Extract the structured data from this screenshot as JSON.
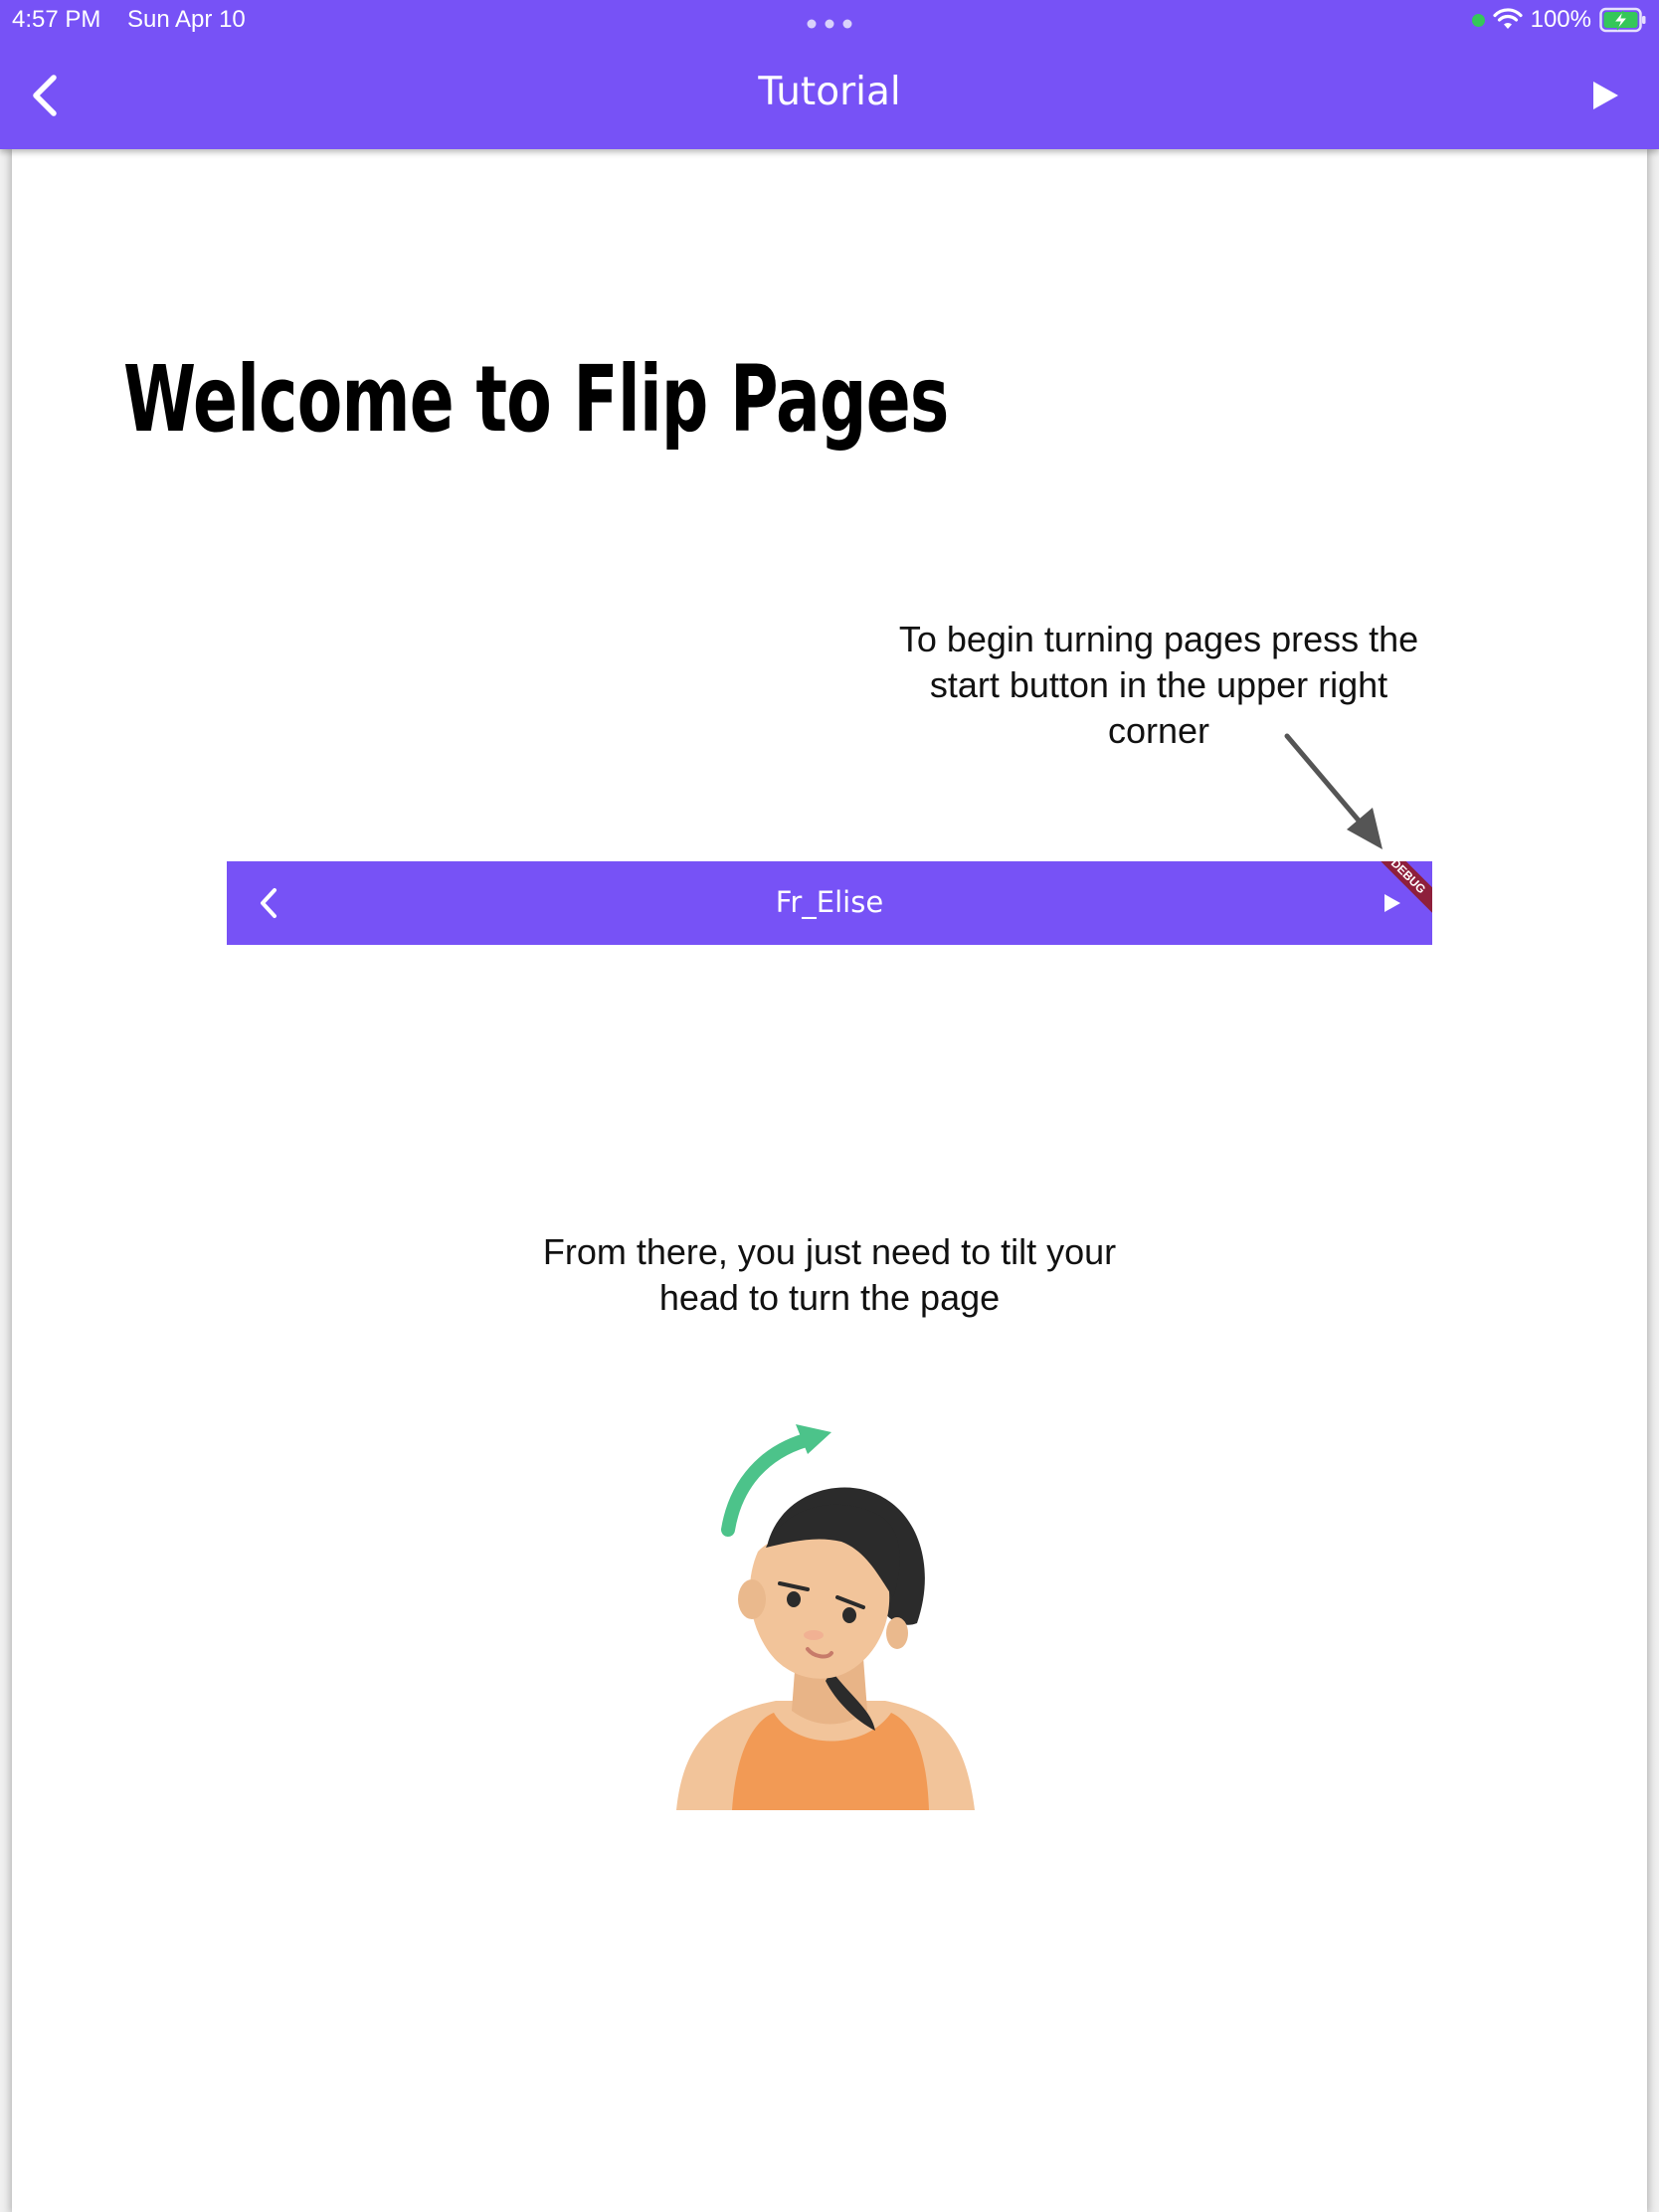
{
  "status_bar": {
    "time": "4:57 PM",
    "date": "Sun Apr 10",
    "battery": "100%",
    "icons": [
      "green-dot-icon",
      "wifi-icon",
      "battery-charging-icon"
    ]
  },
  "nav": {
    "back_icon": "chevron-left-icon",
    "title": "Tutorial",
    "play_icon": "play-icon"
  },
  "page": {
    "title": "Welcome to Flip Pages",
    "instruction_1": "To begin turning pages press the start button in the upper right corner",
    "demo_bar": {
      "title": "Fr_Elise",
      "back_icon": "chevron-left-icon",
      "play_icon": "play-icon",
      "banner": "DEBUG"
    },
    "instruction_2": "From there, you just need to tilt your head to turn the page",
    "illustration": "head-tilt-illustration"
  },
  "colors": {
    "accent": "#7752f6",
    "debug_banner": "#8e1f3b",
    "arrow": "#555555",
    "tilt_arrow": "#4cc38a",
    "skin": "#f2c49a",
    "hair": "#2b2b2b",
    "top": "#f29a55"
  }
}
